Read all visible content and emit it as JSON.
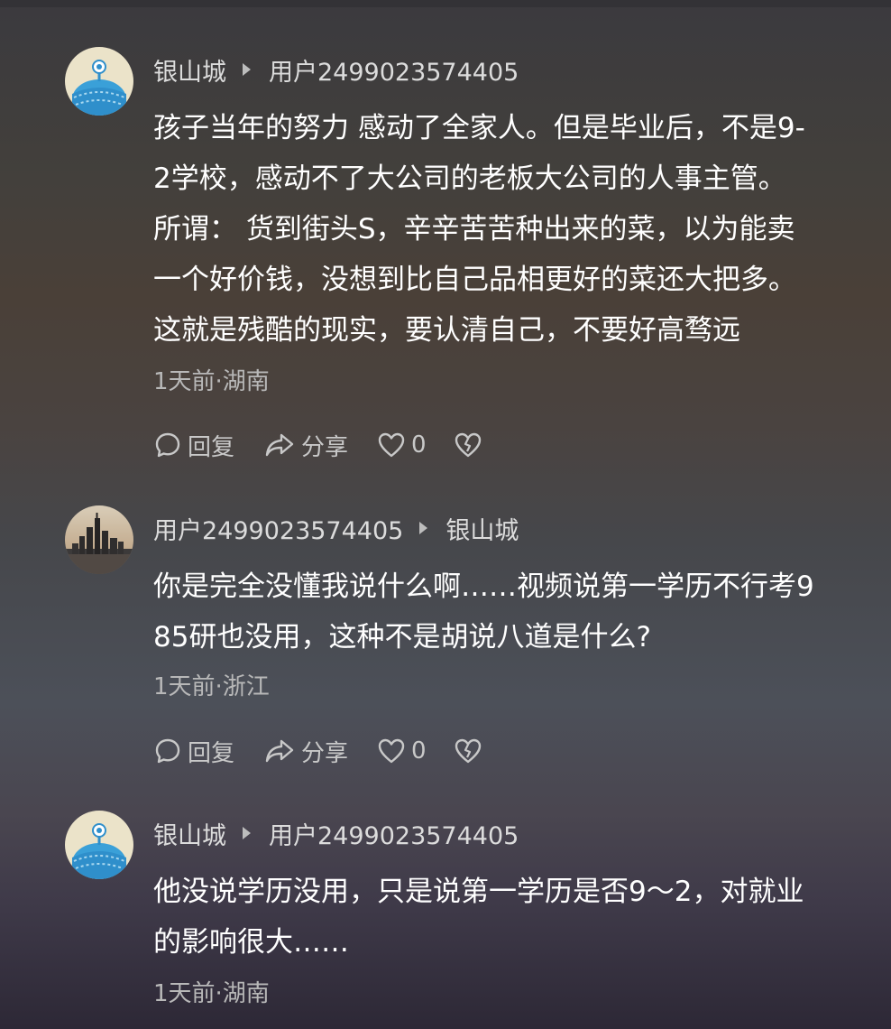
{
  "comments": [
    {
      "author": "银山城",
      "reply_to": "用户2499023574405",
      "avatar": "cartoon-alien-avatar",
      "lines": [
        "孩子当年的努力 感动了全家人。但是毕业后，不是9-",
        "2学校，感动不了大公司的老板大公司的人事主管。",
        "所谓： 货到街头S，辛辛苦苦种出来的菜，以为能卖",
        "一个好价钱，没想到比自己品相更好的菜还大把多。",
        "这就是残酷的现实，要认清自己，不要好高骛远"
      ],
      "meta": "1天前·湖南",
      "actions": {
        "reply": "回复",
        "share": "分享",
        "likes": "0"
      }
    },
    {
      "author": "用户2499023574405",
      "reply_to": "银山城",
      "avatar": "city-skyline-avatar",
      "lines": [
        "你是完全没懂我说什么啊……视频说第一学历不行考9",
        "85研也没用，这种不是胡说八道是什么?"
      ],
      "meta": "1天前·浙江",
      "actions": {
        "reply": "回复",
        "share": "分享",
        "likes": "0"
      }
    },
    {
      "author": "银山城",
      "reply_to": "用户2499023574405",
      "avatar": "cartoon-alien-avatar",
      "lines": [
        "他没说学历没用，只是说第一学历是否9～2，对就业",
        "的影响很大……"
      ],
      "meta": "1天前·湖南"
    }
  ],
  "colors": {
    "text": "#ffffff",
    "secondary": "#b8b8b8",
    "alien_avatar_bg": "#e8e0c8",
    "alien_avatar_body": "#3aa0d8"
  }
}
